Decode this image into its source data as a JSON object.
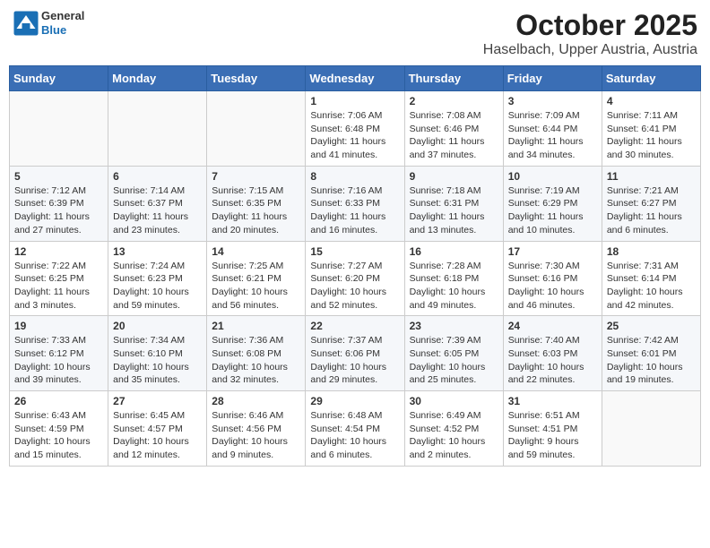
{
  "header": {
    "logo_general": "General",
    "logo_blue": "Blue",
    "month": "October 2025",
    "location": "Haselbach, Upper Austria, Austria"
  },
  "weekdays": [
    "Sunday",
    "Monday",
    "Tuesday",
    "Wednesday",
    "Thursday",
    "Friday",
    "Saturday"
  ],
  "weeks": [
    [
      {
        "day": "",
        "empty": true
      },
      {
        "day": "",
        "empty": true
      },
      {
        "day": "",
        "empty": true
      },
      {
        "day": "1",
        "sunrise": "7:06 AM",
        "sunset": "6:48 PM",
        "daylight": "11 hours and 41 minutes."
      },
      {
        "day": "2",
        "sunrise": "7:08 AM",
        "sunset": "6:46 PM",
        "daylight": "11 hours and 37 minutes."
      },
      {
        "day": "3",
        "sunrise": "7:09 AM",
        "sunset": "6:44 PM",
        "daylight": "11 hours and 34 minutes."
      },
      {
        "day": "4",
        "sunrise": "7:11 AM",
        "sunset": "6:41 PM",
        "daylight": "11 hours and 30 minutes."
      }
    ],
    [
      {
        "day": "5",
        "sunrise": "7:12 AM",
        "sunset": "6:39 PM",
        "daylight": "11 hours and 27 minutes."
      },
      {
        "day": "6",
        "sunrise": "7:14 AM",
        "sunset": "6:37 PM",
        "daylight": "11 hours and 23 minutes."
      },
      {
        "day": "7",
        "sunrise": "7:15 AM",
        "sunset": "6:35 PM",
        "daylight": "11 hours and 20 minutes."
      },
      {
        "day": "8",
        "sunrise": "7:16 AM",
        "sunset": "6:33 PM",
        "daylight": "11 hours and 16 minutes."
      },
      {
        "day": "9",
        "sunrise": "7:18 AM",
        "sunset": "6:31 PM",
        "daylight": "11 hours and 13 minutes."
      },
      {
        "day": "10",
        "sunrise": "7:19 AM",
        "sunset": "6:29 PM",
        "daylight": "11 hours and 10 minutes."
      },
      {
        "day": "11",
        "sunrise": "7:21 AM",
        "sunset": "6:27 PM",
        "daylight": "11 hours and 6 minutes."
      }
    ],
    [
      {
        "day": "12",
        "sunrise": "7:22 AM",
        "sunset": "6:25 PM",
        "daylight": "11 hours and 3 minutes."
      },
      {
        "day": "13",
        "sunrise": "7:24 AM",
        "sunset": "6:23 PM",
        "daylight": "10 hours and 59 minutes."
      },
      {
        "day": "14",
        "sunrise": "7:25 AM",
        "sunset": "6:21 PM",
        "daylight": "10 hours and 56 minutes."
      },
      {
        "day": "15",
        "sunrise": "7:27 AM",
        "sunset": "6:20 PM",
        "daylight": "10 hours and 52 minutes."
      },
      {
        "day": "16",
        "sunrise": "7:28 AM",
        "sunset": "6:18 PM",
        "daylight": "10 hours and 49 minutes."
      },
      {
        "day": "17",
        "sunrise": "7:30 AM",
        "sunset": "6:16 PM",
        "daylight": "10 hours and 46 minutes."
      },
      {
        "day": "18",
        "sunrise": "7:31 AM",
        "sunset": "6:14 PM",
        "daylight": "10 hours and 42 minutes."
      }
    ],
    [
      {
        "day": "19",
        "sunrise": "7:33 AM",
        "sunset": "6:12 PM",
        "daylight": "10 hours and 39 minutes."
      },
      {
        "day": "20",
        "sunrise": "7:34 AM",
        "sunset": "6:10 PM",
        "daylight": "10 hours and 35 minutes."
      },
      {
        "day": "21",
        "sunrise": "7:36 AM",
        "sunset": "6:08 PM",
        "daylight": "10 hours and 32 minutes."
      },
      {
        "day": "22",
        "sunrise": "7:37 AM",
        "sunset": "6:06 PM",
        "daylight": "10 hours and 29 minutes."
      },
      {
        "day": "23",
        "sunrise": "7:39 AM",
        "sunset": "6:05 PM",
        "daylight": "10 hours and 25 minutes."
      },
      {
        "day": "24",
        "sunrise": "7:40 AM",
        "sunset": "6:03 PM",
        "daylight": "10 hours and 22 minutes."
      },
      {
        "day": "25",
        "sunrise": "7:42 AM",
        "sunset": "6:01 PM",
        "daylight": "10 hours and 19 minutes."
      }
    ],
    [
      {
        "day": "26",
        "sunrise": "6:43 AM",
        "sunset": "4:59 PM",
        "daylight": "10 hours and 15 minutes."
      },
      {
        "day": "27",
        "sunrise": "6:45 AM",
        "sunset": "4:57 PM",
        "daylight": "10 hours and 12 minutes."
      },
      {
        "day": "28",
        "sunrise": "6:46 AM",
        "sunset": "4:56 PM",
        "daylight": "10 hours and 9 minutes."
      },
      {
        "day": "29",
        "sunrise": "6:48 AM",
        "sunset": "4:54 PM",
        "daylight": "10 hours and 6 minutes."
      },
      {
        "day": "30",
        "sunrise": "6:49 AM",
        "sunset": "4:52 PM",
        "daylight": "10 hours and 2 minutes."
      },
      {
        "day": "31",
        "sunrise": "6:51 AM",
        "sunset": "4:51 PM",
        "daylight": "9 hours and 59 minutes."
      },
      {
        "day": "",
        "empty": true
      }
    ]
  ],
  "labels": {
    "sunrise": "Sunrise:",
    "sunset": "Sunset:",
    "daylight": "Daylight:"
  }
}
